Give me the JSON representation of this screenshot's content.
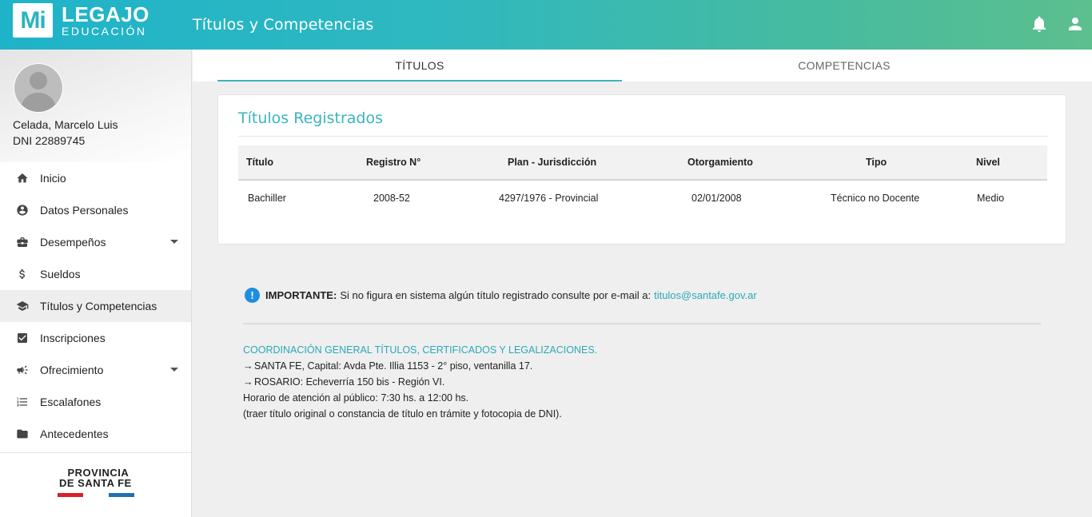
{
  "header": {
    "logo_mark": "Mi",
    "logo_title": "LEGAJO",
    "logo_subtitle": "EDUCACIÓN",
    "page_title": "Títulos y Competencias",
    "accent_color": "#3ab5c0"
  },
  "profile": {
    "name": "Celada, Marcelo Luis",
    "dni": "DNI 22889745"
  },
  "sidebar": {
    "items": [
      {
        "label": "Inicio",
        "icon": "home-icon",
        "caret": false,
        "active": false
      },
      {
        "label": "Datos Personales",
        "icon": "account-circle-icon",
        "caret": false,
        "active": false
      },
      {
        "label": "Desempeños",
        "icon": "briefcase-icon",
        "caret": true,
        "active": false
      },
      {
        "label": "Sueldos",
        "icon": "dollar-icon",
        "caret": false,
        "active": false
      },
      {
        "label": "Títulos y Competencias",
        "icon": "graduation-cap-icon",
        "caret": false,
        "active": true
      },
      {
        "label": "Inscripciones",
        "icon": "checkbox-icon",
        "caret": false,
        "active": false
      },
      {
        "label": "Ofrecimiento",
        "icon": "megaphone-icon",
        "caret": true,
        "active": false
      },
      {
        "label": "Escalafones",
        "icon": "list-icon",
        "caret": false,
        "active": false
      },
      {
        "label": "Antecedentes",
        "icon": "folder-icon",
        "caret": false,
        "active": false
      }
    ],
    "footer_line1": "PROVINCIA",
    "footer_line2": "DE SANTA FE"
  },
  "tabs": [
    {
      "label": "TÍTULOS",
      "active": true
    },
    {
      "label": "COMPETENCIAS",
      "active": false
    }
  ],
  "card": {
    "title": "Títulos Registrados",
    "columns": [
      "Título",
      "Registro N°",
      "Plan - Jurisdicción",
      "Otorgamiento",
      "Tipo",
      "Nivel"
    ],
    "rows": [
      [
        "Bachiller",
        "2008-52",
        "4297/1976 - Provincial",
        "02/01/2008",
        "Técnico no Docente",
        "Medio"
      ]
    ]
  },
  "notice": {
    "label": "IMPORTANTE:",
    "text": "Si no figura en sistema algún título registrado consulte por e-mail a:",
    "email": "titulos@santafe.gov.ar"
  },
  "info": {
    "heading": "COORDINACIÓN GENERAL TÍTULOS, CERTIFICADOS Y LEGALIZACIONES.",
    "line1": "SANTA FE, Capital: Avda Pte. Illia 1153 - 2° piso, ventanilla 17.",
    "line2": "ROSARIO: Echeverría 150 bis - Región VI.",
    "line3": "Horario de atención al público: 7:30 hs. a 12:00 hs.",
    "line4": "(traer título original o constancia de título en trámite y fotocopia de DNI)."
  }
}
